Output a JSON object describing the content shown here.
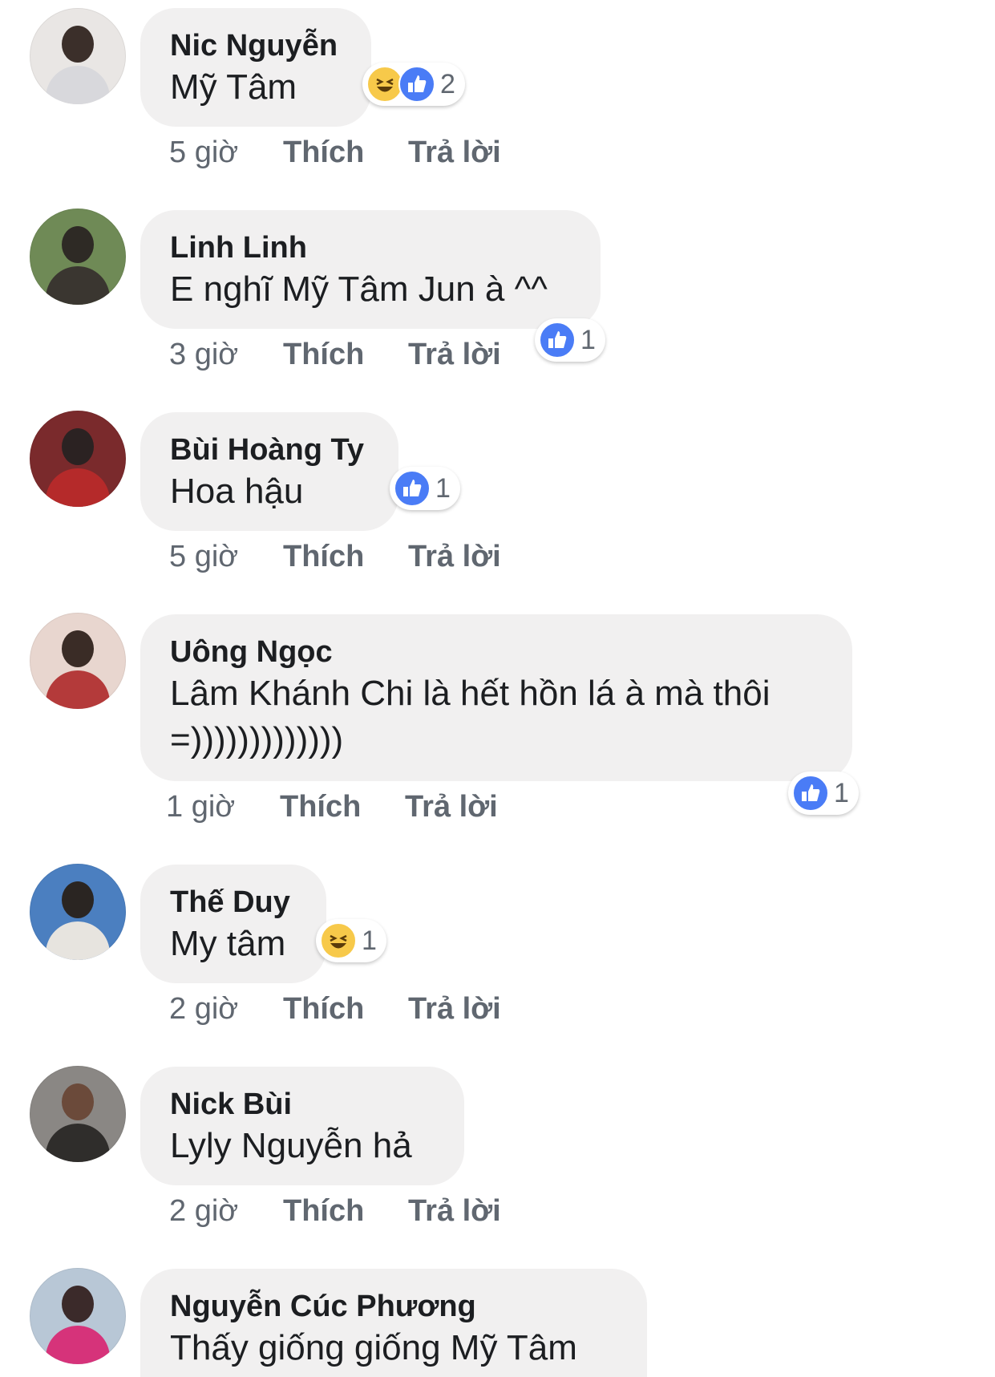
{
  "colors": {
    "bubble": "#f1f0f0",
    "meta_text": "#606770",
    "like_blue": "#4a7cf6",
    "haha_yellow": "#f7c94a"
  },
  "comments": [
    {
      "author": "Nic Nguyễn",
      "lines": [
        "Mỹ Tâm"
      ],
      "time": "5 giờ",
      "like_label": "Thích",
      "reply_label": "Trả lời",
      "reactions": [
        "haha",
        "like"
      ],
      "reaction_count": "2"
    },
    {
      "author": "Linh Linh",
      "lines": [
        "E nghĩ Mỹ Tâm Jun à ^^"
      ],
      "time": "3 giờ",
      "like_label": "Thích",
      "reply_label": "Trả lời",
      "reactions": [
        "like"
      ],
      "reaction_count": "1"
    },
    {
      "author": "Bùi Hoàng Ty",
      "lines": [
        "Hoa hậu"
      ],
      "time": "5 giờ",
      "like_label": "Thích",
      "reply_label": "Trả lời",
      "reactions": [
        "like"
      ],
      "reaction_count": "1"
    },
    {
      "author": "Uông Ngọc",
      "lines": [
        "Lâm Khánh Chi là hết hồn lá à mà thôi",
        "=)))))))))))))"
      ],
      "time": "1 giờ",
      "like_label": "Thích",
      "reply_label": "Trả lời",
      "reactions": [
        "like"
      ],
      "reaction_count": "1"
    },
    {
      "author": "Thế Duy",
      "lines": [
        "My tâm"
      ],
      "time": "2 giờ",
      "like_label": "Thích",
      "reply_label": "Trả lời",
      "reactions": [
        "haha"
      ],
      "reaction_count": "1"
    },
    {
      "author": "Nick Bùi",
      "lines": [
        "Lyly Nguyễn hả"
      ],
      "time": "2 giờ",
      "like_label": "Thích",
      "reply_label": "Trả lời",
      "reactions": [],
      "reaction_count": ""
    },
    {
      "author": "Nguyễn Cúc Phương",
      "lines": [
        "Thấy giống giống Mỹ Tâm"
      ],
      "time": "",
      "like_label": "",
      "reply_label": "",
      "reactions": [],
      "reaction_count": ""
    }
  ]
}
